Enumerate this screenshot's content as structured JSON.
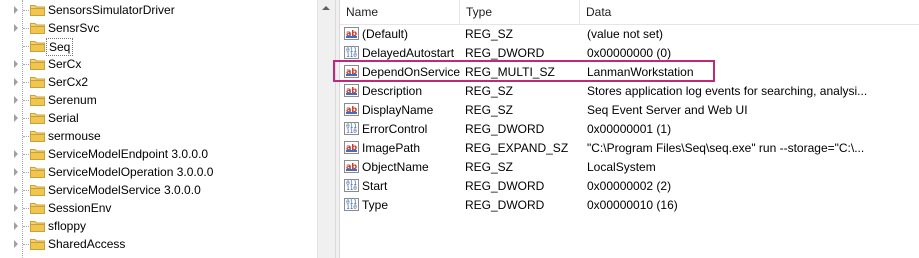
{
  "tree": {
    "items": [
      {
        "label": "SensorsSimulatorDriver",
        "expandable": true,
        "selected": false
      },
      {
        "label": "SensrSvc",
        "expandable": true,
        "selected": false
      },
      {
        "label": "Seq",
        "expandable": false,
        "selected": true
      },
      {
        "label": "SerCx",
        "expandable": true,
        "selected": false
      },
      {
        "label": "SerCx2",
        "expandable": true,
        "selected": false
      },
      {
        "label": "Serenum",
        "expandable": true,
        "selected": false
      },
      {
        "label": "Serial",
        "expandable": true,
        "selected": false
      },
      {
        "label": "sermouse",
        "expandable": false,
        "selected": false
      },
      {
        "label": "ServiceModelEndpoint 3.0.0.0",
        "expandable": true,
        "selected": false
      },
      {
        "label": "ServiceModelOperation 3.0.0.0",
        "expandable": true,
        "selected": false
      },
      {
        "label": "ServiceModelService 3.0.0.0",
        "expandable": true,
        "selected": false
      },
      {
        "label": "SessionEnv",
        "expandable": true,
        "selected": false
      },
      {
        "label": "sfloppy",
        "expandable": true,
        "selected": false
      },
      {
        "label": "SharedAccess",
        "expandable": true,
        "selected": false
      }
    ]
  },
  "list": {
    "columns": {
      "name": "Name",
      "type": "Type",
      "data": "Data"
    },
    "rows": [
      {
        "icon": "string-value-icon",
        "name": "(Default)",
        "type": "REG_SZ",
        "data": "(value not set)"
      },
      {
        "icon": "binary-value-icon",
        "name": "DelayedAutostart",
        "type": "REG_DWORD",
        "data": "0x00000000 (0)"
      },
      {
        "icon": "string-value-icon",
        "name": "DependOnService",
        "type": "REG_MULTI_SZ",
        "data": "LanmanWorkstation"
      },
      {
        "icon": "string-value-icon",
        "name": "Description",
        "type": "REG_SZ",
        "data": "Stores application log events for searching, analysi..."
      },
      {
        "icon": "string-value-icon",
        "name": "DisplayName",
        "type": "REG_SZ",
        "data": "Seq Event Server and Web UI"
      },
      {
        "icon": "binary-value-icon",
        "name": "ErrorControl",
        "type": "REG_DWORD",
        "data": "0x00000001 (1)"
      },
      {
        "icon": "string-value-icon",
        "name": "ImagePath",
        "type": "REG_EXPAND_SZ",
        "data": "\"C:\\Program Files\\Seq\\seq.exe\" run --storage=\"C:\\..."
      },
      {
        "icon": "string-value-icon",
        "name": "ObjectName",
        "type": "REG_SZ",
        "data": "LocalSystem"
      },
      {
        "icon": "binary-value-icon",
        "name": "Start",
        "type": "REG_DWORD",
        "data": "0x00000002 (2)"
      },
      {
        "icon": "binary-value-icon",
        "name": "Type",
        "type": "REG_DWORD",
        "data": "0x00000010 (16)"
      }
    ]
  },
  "icons": {
    "string_glyph": "ab",
    "dword_glyph": "011\n110"
  },
  "colors": {
    "highlight": "#c0297a",
    "folder": "#e8c34a"
  }
}
